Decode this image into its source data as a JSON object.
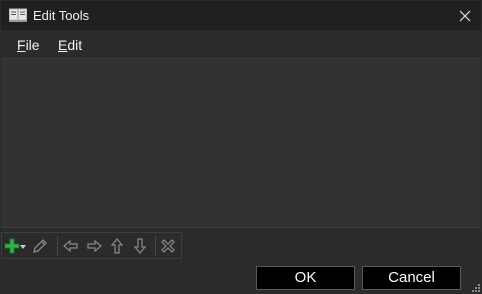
{
  "window": {
    "title": "Edit Tools",
    "title_icon": "book-icon"
  },
  "menubar": {
    "items": [
      {
        "label_accel": "F",
        "label_rest": "ile"
      },
      {
        "label_accel": "E",
        "label_rest": "dit"
      }
    ]
  },
  "toolbar": {
    "icons": [
      "add-icon",
      "dropdown-arrow-icon",
      "edit-pencil-icon",
      "move-left-icon",
      "move-right-icon",
      "move-up-icon",
      "move-down-icon",
      "delete-icon"
    ]
  },
  "buttons": {
    "ok": "OK",
    "cancel": "Cancel"
  },
  "colors": {
    "window_bg": "#2b2b2b",
    "titlebar_bg": "#202020",
    "content_bg": "#323232",
    "add_icon_green": "#2fb344"
  }
}
